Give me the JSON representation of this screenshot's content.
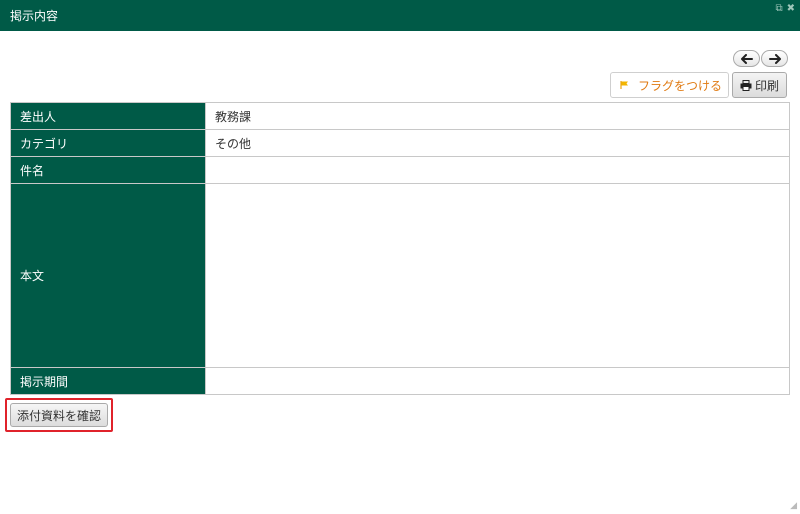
{
  "window": {
    "title": "掲示内容",
    "icons": [
      "popout-icon",
      "close-icon"
    ]
  },
  "toolbar": {
    "prev_icon": "arrow-left-icon",
    "next_icon": "arrow-right-icon",
    "flag_label": "フラグをつける",
    "flag_icon": "flag-icon",
    "print_label": "印刷",
    "print_icon": "printer-icon"
  },
  "detail": {
    "sender_label": "差出人",
    "sender_value": "教務課",
    "category_label": "カテゴリ",
    "category_value": "その他",
    "subject_label": "件名",
    "subject_value": "",
    "body_label": "本文",
    "body_value": "",
    "period_label": "掲示期間",
    "period_value": ""
  },
  "actions": {
    "attachment_label": "添付資料を確認"
  },
  "colors": {
    "header_green": "#005a47",
    "flag_orange": "#e07a12",
    "highlight_red": "#e0232b"
  }
}
